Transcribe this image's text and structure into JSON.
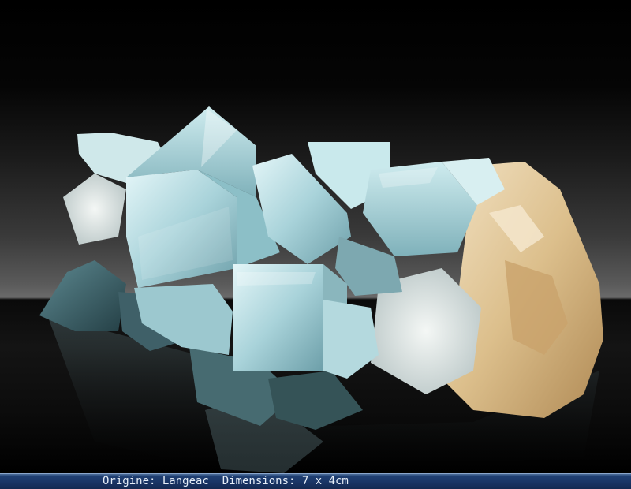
{
  "caption": {
    "text": "Origine: Langeac  Dimensions: 7 x 4cm"
  },
  "colors": {
    "crystal": "#b8dde3",
    "matrix": "#e2c9a0",
    "caption_bar": "#1a3566"
  }
}
